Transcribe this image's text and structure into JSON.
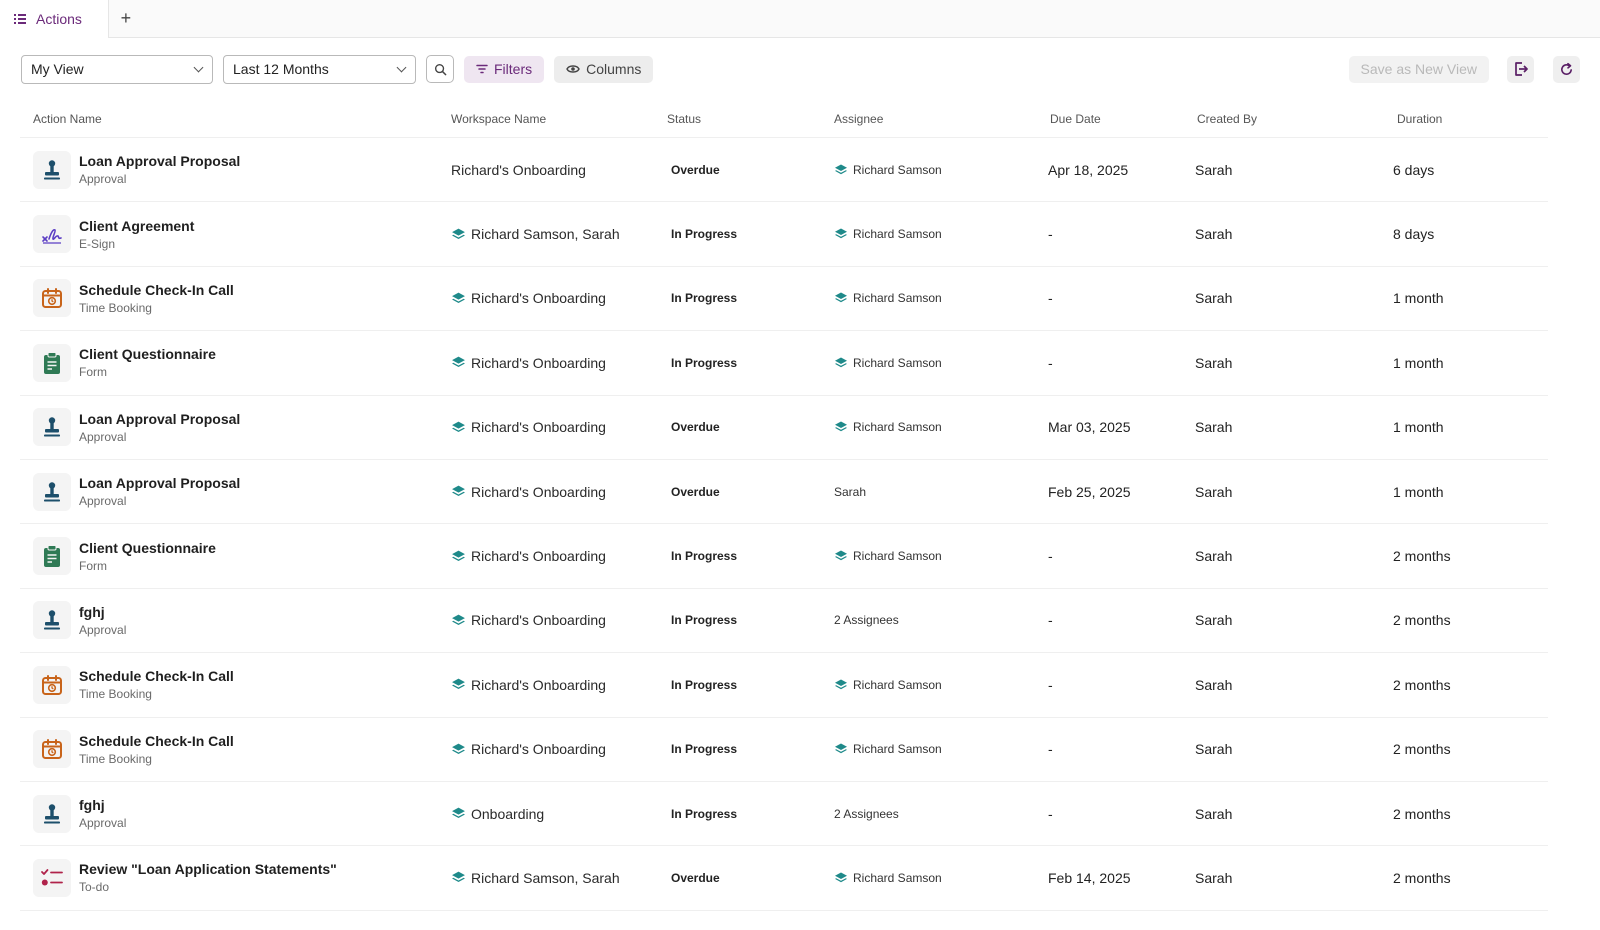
{
  "tabs": {
    "active_label": "Actions",
    "add_symbol": "+"
  },
  "toolbar": {
    "view_select": "My View",
    "range_select": "Last 12 Months",
    "filters_label": "Filters",
    "columns_label": "Columns",
    "save_view_label": "Save as New View"
  },
  "colors": {
    "brand_purple": "#6b2a7a",
    "workspace_teal": "#1f8a8a",
    "approval_navy": "#1d4f6b",
    "esign_purple": "#5b3ec4",
    "timebooking_orange": "#c8641a",
    "form_green": "#2f7a55",
    "todo_crimson": "#b0234b"
  },
  "table": {
    "headers": {
      "action_name": "Action Name",
      "workspace_name": "Workspace Name",
      "status": "Status",
      "assignee": "Assignee",
      "due_date": "Due Date",
      "created_by": "Created By",
      "duration": "Duration"
    },
    "rows": [
      {
        "title": "Loan Approval Proposal",
        "type": "Approval",
        "icon": "stamp-icon",
        "workspace": "Richard's Onboarding",
        "ws_icon": false,
        "status": "Overdue",
        "assignee": "Richard Samson",
        "as_icon": true,
        "due": "Apr 18, 2025",
        "created_by": "Sarah",
        "duration": "6 days"
      },
      {
        "title": "Client Agreement",
        "type": "E-Sign",
        "icon": "signature-icon",
        "workspace": "Richard Samson, Sarah",
        "ws_icon": true,
        "status": "In Progress",
        "assignee": "Richard Samson",
        "as_icon": true,
        "due": "-",
        "created_by": "Sarah",
        "duration": "8 days"
      },
      {
        "title": "Schedule Check-In Call",
        "type": "Time Booking",
        "icon": "calendar-icon",
        "workspace": "Richard's Onboarding",
        "ws_icon": true,
        "status": "In Progress",
        "assignee": "Richard Samson",
        "as_icon": true,
        "due": "-",
        "created_by": "Sarah",
        "duration": "1 month"
      },
      {
        "title": "Client Questionnaire",
        "type": "Form",
        "icon": "clipboard-icon",
        "workspace": "Richard's Onboarding",
        "ws_icon": true,
        "status": "In Progress",
        "assignee": "Richard Samson",
        "as_icon": true,
        "due": "-",
        "created_by": "Sarah",
        "duration": "1 month"
      },
      {
        "title": "Loan Approval Proposal",
        "type": "Approval",
        "icon": "stamp-icon",
        "workspace": "Richard's Onboarding",
        "ws_icon": true,
        "status": "Overdue",
        "assignee": "Richard Samson",
        "as_icon": true,
        "due": "Mar 03, 2025",
        "created_by": "Sarah",
        "duration": "1 month"
      },
      {
        "title": "Loan Approval Proposal",
        "type": "Approval",
        "icon": "stamp-icon",
        "workspace": "Richard's Onboarding",
        "ws_icon": true,
        "status": "Overdue",
        "assignee": "Sarah",
        "as_icon": false,
        "due": "Feb 25, 2025",
        "created_by": "Sarah",
        "duration": "1 month"
      },
      {
        "title": "Client Questionnaire",
        "type": "Form",
        "icon": "clipboard-icon",
        "workspace": "Richard's Onboarding",
        "ws_icon": true,
        "status": "In Progress",
        "assignee": "Richard Samson",
        "as_icon": true,
        "due": "-",
        "created_by": "Sarah",
        "duration": "2 months"
      },
      {
        "title": "fghj",
        "type": "Approval",
        "icon": "stamp-icon",
        "workspace": "Richard's Onboarding",
        "ws_icon": true,
        "status": "In Progress",
        "assignee": "2 Assignees",
        "as_icon": false,
        "due": "-",
        "created_by": "Sarah",
        "duration": "2 months"
      },
      {
        "title": "Schedule Check-In Call",
        "type": "Time Booking",
        "icon": "calendar-icon",
        "workspace": "Richard's Onboarding",
        "ws_icon": true,
        "status": "In Progress",
        "assignee": "Richard Samson",
        "as_icon": true,
        "due": "-",
        "created_by": "Sarah",
        "duration": "2 months"
      },
      {
        "title": "Schedule Check-In Call",
        "type": "Time Booking",
        "icon": "calendar-icon",
        "workspace": "Richard's Onboarding",
        "ws_icon": true,
        "status": "In Progress",
        "assignee": "Richard Samson",
        "as_icon": true,
        "due": "-",
        "created_by": "Sarah",
        "duration": "2 months"
      },
      {
        "title": "fghj",
        "type": "Approval",
        "icon": "stamp-icon",
        "workspace": "Onboarding",
        "ws_icon": true,
        "status": "In Progress",
        "assignee": "2 Assignees",
        "as_icon": false,
        "due": "-",
        "created_by": "Sarah",
        "duration": "2 months"
      },
      {
        "title": "Review \"Loan Application Statements\"",
        "type": "To-do",
        "icon": "todo-list-icon",
        "workspace": "Richard Samson, Sarah",
        "ws_icon": true,
        "status": "Overdue",
        "assignee": "Richard Samson",
        "as_icon": true,
        "due": "Feb 14, 2025",
        "created_by": "Sarah",
        "duration": "2 months"
      }
    ]
  }
}
